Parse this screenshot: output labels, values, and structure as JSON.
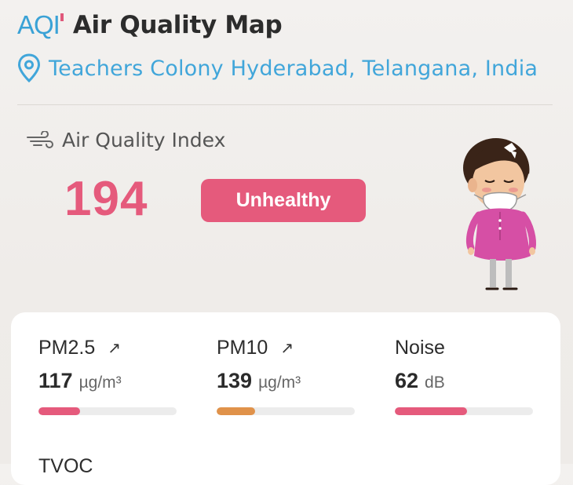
{
  "header": {
    "logo_text": "AQI",
    "title": "Air Quality Map",
    "location": "Teachers Colony Hyderabad, Telangana, India"
  },
  "aqi": {
    "label": "Air Quality Index",
    "value": "194",
    "status": "Unhealthy",
    "status_color": "#e55a7c"
  },
  "metrics": [
    {
      "name": "PM2.5",
      "trend_icon": "arrow-up-right-icon",
      "trend": "↗",
      "value": "117",
      "unit": "µg/m³",
      "level": 0.3,
      "color": "#e55a7c"
    },
    {
      "name": "PM10",
      "trend_icon": "arrow-up-right-icon",
      "trend": "↗",
      "value": "139",
      "unit": "µg/m³",
      "level": 0.28,
      "color": "#e0924a"
    },
    {
      "name": "Noise",
      "value": "62",
      "unit": "dB",
      "level": 0.52,
      "color": "#e55a7c"
    }
  ],
  "partial_metric": {
    "name": "TVOC"
  },
  "colors": {
    "brand": "#3aa2d6",
    "accent": "#e55a7c"
  }
}
